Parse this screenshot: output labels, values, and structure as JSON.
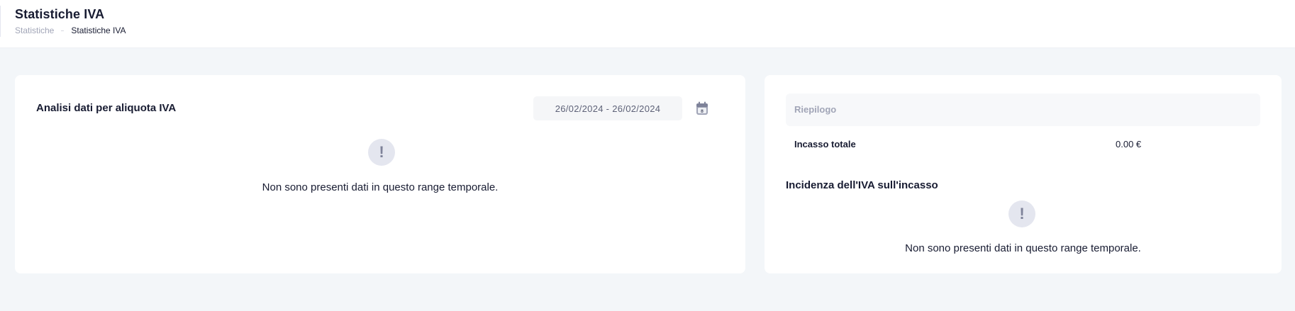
{
  "header": {
    "title": "Statistiche IVA",
    "breadcrumb": {
      "parent": "Statistiche",
      "current": "Statistiche IVA"
    }
  },
  "left_card": {
    "title": "Analisi dati per aliquota IVA",
    "date_range": "26/02/2024 - 26/02/2024",
    "calendar_icon": "calendar-icon",
    "empty_icon": "exclamation-icon",
    "empty_message": "Non sono presenti dati in questo range temporale."
  },
  "right_card": {
    "summary_title": "Riepilogo",
    "total_label": "Incasso totale",
    "total_value": "0.00 €",
    "incidence_title": "Incidenza dell'IVA sull'incasso",
    "empty_icon": "exclamation-icon",
    "empty_message": "Non sono presenti dati in questo range temporale."
  },
  "colors": {
    "background": "#f3f6f9",
    "card": "#ffffff",
    "muted_text": "#a1a5b7",
    "icon_bg": "#e4e6ef"
  }
}
